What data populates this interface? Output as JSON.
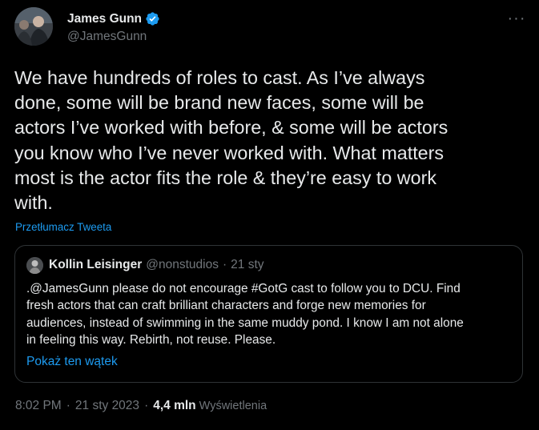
{
  "author": {
    "display_name": "James Gunn",
    "handle": "@JamesGunn",
    "verified_icon": "verified-badge-icon",
    "more_icon": "more-horizontal-icon",
    "more_label": "···"
  },
  "tweet": {
    "text_lines": [
      "We have hundreds of roles to cast. As I’ve always",
      "done, some will be brand new faces, some will be",
      "actors I’ve worked with before, & some will be actors",
      "you know who I’ve never worked with. What matters",
      "most is the actor fits the role & they’re easy to work",
      "with."
    ],
    "translate_label": "Przetłumacz Tweeta"
  },
  "quote": {
    "name": "Kollin Leisinger",
    "handle": "@nonstudios",
    "separator": "·",
    "date": "21 sty",
    "text_lines": [
      ".@JamesGunn please do not encourage #GotG cast to follow you to DCU. Find",
      "fresh actors that can craft brilliant characters and forge new memories for",
      "audiences, instead of swimming in the same muddy pond. I know I am not alone",
      "in feeling this way. Rebirth, not reuse. Please."
    ],
    "show_thread_label": "Pokaż ten wątek"
  },
  "meta": {
    "time": "8:02 PM",
    "separator": "·",
    "date": "21 sty 2023",
    "views_count": "4,4 mln",
    "views_label": "Wyświetlenia"
  },
  "colors": {
    "background": "#000000",
    "text": "#e7e9ea",
    "muted": "#71767b",
    "accent": "#1d9bf0",
    "border": "#2f3336"
  }
}
